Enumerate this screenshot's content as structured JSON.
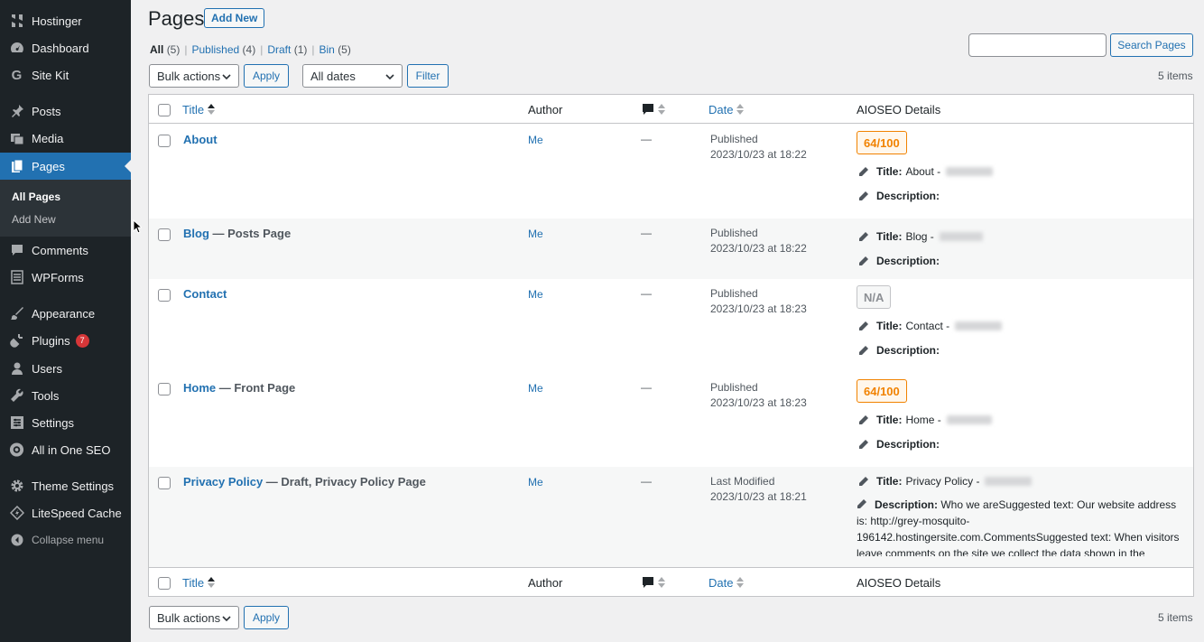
{
  "sidebar": {
    "items": [
      {
        "icon": "hostinger-icon",
        "label": "Hostinger"
      },
      {
        "icon": "dashboard-icon",
        "label": "Dashboard"
      },
      {
        "icon": "google-icon",
        "label": "Site Kit"
      },
      {
        "icon": "pin-icon",
        "label": "Posts"
      },
      {
        "icon": "media-icon",
        "label": "Media"
      },
      {
        "icon": "pages-icon",
        "label": "Pages"
      },
      {
        "icon": "comment-icon",
        "label": "Comments"
      },
      {
        "icon": "form-icon",
        "label": "WPForms"
      },
      {
        "icon": "brush-icon",
        "label": "Appearance"
      },
      {
        "icon": "plug-icon",
        "label": "Plugins",
        "badge": "7"
      },
      {
        "icon": "user-icon",
        "label": "Users"
      },
      {
        "icon": "wrench-icon",
        "label": "Tools"
      },
      {
        "icon": "settings-icon",
        "label": "Settings"
      },
      {
        "icon": "aioseo-icon",
        "label": "All in One SEO"
      },
      {
        "icon": "gear-icon",
        "label": "Theme Settings"
      },
      {
        "icon": "litespeed-icon",
        "label": "LiteSpeed Cache"
      }
    ],
    "submenu": {
      "all_pages": "All Pages",
      "add_new": "Add New"
    },
    "collapse": "Collapse menu"
  },
  "header": {
    "title": "Pages",
    "add_new": "Add New"
  },
  "filters": {
    "all": "All",
    "all_count": "(5)",
    "published": "Published",
    "published_count": "(4)",
    "draft": "Draft",
    "draft_count": "(1)",
    "bin": "Bin",
    "bin_count": "(5)",
    "sep": "|"
  },
  "search": {
    "placeholder": "",
    "button": "Search Pages"
  },
  "toolbar": {
    "bulk_actions": "Bulk actions",
    "apply": "Apply",
    "all_dates": "All dates",
    "filter": "Filter",
    "items_count": "5 items"
  },
  "columns": {
    "title": "Title",
    "author": "Author",
    "date": "Date",
    "aioseo": "AIOSEO Details"
  },
  "seo_labels": {
    "title": "Title:",
    "description": "Description:"
  },
  "rows": [
    {
      "title": "About",
      "state": "",
      "author": "Me",
      "comments": "—",
      "status": "Published",
      "date": "2023/10/23 at 18:22",
      "score": "64/100",
      "seo_title": "About -",
      "seo_desc": ""
    },
    {
      "title": "Blog",
      "state": " — Posts Page",
      "author": "Me",
      "comments": "—",
      "status": "Published",
      "date": "2023/10/23 at 18:22",
      "score": "",
      "seo_title": "Blog -",
      "seo_desc": ""
    },
    {
      "title": "Contact",
      "state": "",
      "author": "Me",
      "comments": "—",
      "status": "Published",
      "date": "2023/10/23 at 18:23",
      "score": "N/A",
      "seo_title": "Contact -",
      "seo_desc": ""
    },
    {
      "title": "Home",
      "state": " — Front Page",
      "author": "Me",
      "comments": "—",
      "status": "Published",
      "date": "2023/10/23 at 18:23",
      "score": "64/100",
      "seo_title": "Home -",
      "seo_desc": ""
    },
    {
      "title": "Privacy Policy",
      "state": " — Draft, Privacy Policy Page",
      "author": "Me",
      "comments": "—",
      "status": "Last Modified",
      "date": "2023/10/23 at 18:21",
      "score": "",
      "seo_title": "Privacy Policy -",
      "seo_desc": "Who we areSuggested text: Our website address is: http://grey-mosquito-196142.hostingersite.com.CommentsSuggested text: When visitors leave comments on the site we collect the data shown in the"
    }
  ]
}
